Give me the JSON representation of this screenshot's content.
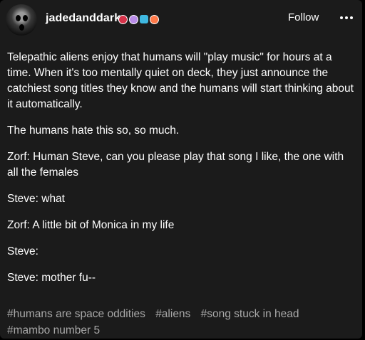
{
  "post": {
    "username": "jadedanddark",
    "follow_label": "Follow",
    "more_icon": "ellipsis-icon",
    "badges": [
      "red-badge-icon",
      "purple-badge-icon",
      "blue-badge-icon",
      "orange-badge-icon"
    ],
    "paragraphs": [
      "Telepathic aliens enjoy that humans will \"play music\" for hours at a time. When it's too mentally quiet on deck, they just announce the catchiest song titles they know and the humans will start thinking about it automatically.",
      "The humans hate this so, so much.",
      "Zorf: Human Steve, can you please play that song I like, the one with all the females",
      "Steve: what",
      "Zorf: A little bit of Monica in my life",
      "Steve:",
      "Steve: mother fu--"
    ],
    "tags": [
      "#humans are space oddities",
      "#aliens",
      "#song stuck in head",
      "#mambo number 5"
    ]
  },
  "colors": {
    "page_background": "#000000",
    "card_background": "#1b1b1b",
    "text": "#ffffff",
    "tag_text": "#a8a8a8"
  }
}
